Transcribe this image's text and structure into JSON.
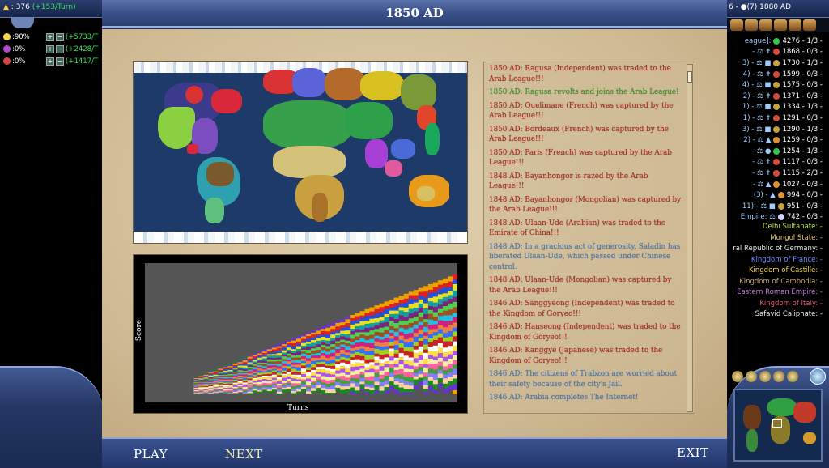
{
  "left_hud": {
    "gold": ": 376",
    "gold_rate": "(+153/Turn)",
    "rates": [
      {
        "label": ":90%",
        "gain": "(+5733/T",
        "color": "#f4d54a"
      },
      {
        "label": ":0%",
        "gain": "(+2428/T",
        "color": "#b24ad0"
      },
      {
        "label": ":0%",
        "gain": "(+1417/T",
        "color": "#d84444"
      }
    ]
  },
  "right_hud": {
    "top": "6 - ●(7) 1880 AD",
    "rows": [
      {
        "pre": "eague]:",
        "score": "4276 - 1/3 -",
        "color": "#2fc848"
      },
      {
        "pre": "- ⚖ ✝",
        "score": "1868 - 0/3 -",
        "color": "#d84b3b"
      },
      {
        "pre": "3) - ⚖ ■",
        "score": "1730 - 1/3 -",
        "color": "#c9a23a"
      },
      {
        "pre": "4) - ⚖ ✝",
        "score": "1599 - 0/3 -",
        "color": "#d84b3b"
      },
      {
        "pre": "4) - ⚖ ■",
        "score": "1575 - 0/3 -",
        "color": "#c9a23a"
      },
      {
        "pre": "2) - ⚖ ✝",
        "score": "1371 - 0/3 -",
        "color": "#d84b3b"
      },
      {
        "pre": "1) - ⚖ ■",
        "score": "1334 - 1/3 -",
        "color": "#c9a23a"
      },
      {
        "pre": "1) - ⚖ ✝",
        "score": "1291 - 0/3 -",
        "color": "#d84b3b"
      },
      {
        "pre": "3) - ⚖ ■",
        "score": "1290 - 1/3 -",
        "color": "#c9a23a"
      },
      {
        "pre": "2) - ⚖ ▲",
        "score": "1259 - 0/3 -",
        "color": "#e0902e"
      },
      {
        "pre": "- ⚖ ●",
        "score": "1254 - 1/3 -",
        "color": "#2fc848"
      },
      {
        "pre": "- ⚖ ✝",
        "score": "1117 - 0/3 -",
        "color": "#d84b3b"
      },
      {
        "pre": "- ⚖ ✝",
        "score": "1115 - 2/3 -",
        "color": "#d84b3b"
      },
      {
        "pre": "- ⚖ ▲",
        "score": "1027 - 0/3 -",
        "color": "#e0902e"
      },
      {
        "pre": "(3) - ▲",
        "score": "994 - 0/3 -",
        "color": "#e0902e"
      },
      {
        "pre": "11) - ⚖ ■",
        "score": "951 - 0/3 -",
        "color": "#c9a23a"
      },
      {
        "pre": "Empire: ⚖",
        "score": "742 - 0/3 -",
        "color": "#d8d8ff"
      }
    ],
    "civs": [
      {
        "name": "Delhi Sultanate:  -",
        "color": "#b9e04a"
      },
      {
        "name": "Mongol State:  -",
        "color": "#e0c46a"
      },
      {
        "name": "ral Republic of Germany:  -",
        "color": "#e8e8e8"
      },
      {
        "name": "Kingdom of France:  -",
        "color": "#6b8cff"
      },
      {
        "name": "Kingdom of Castille:  -",
        "color": "#f2d44a"
      },
      {
        "name": "Kingdom of Cambodia:  -",
        "color": "#c7a27a"
      },
      {
        "name": "Eastern Roman Empire:  -",
        "color": "#c27adf"
      },
      {
        "name": "Kingdom of Italy:  -",
        "color": "#e25a6a"
      },
      {
        "name": "Safavid Caliphate:  -",
        "color": "#e8e8e8"
      }
    ]
  },
  "dialog": {
    "title": "1850 AD",
    "graph_ylabel": "Score",
    "graph_xlabel": "Turns",
    "buttons": {
      "play": "PLAY",
      "next": "NEXT",
      "exit": "EXIT"
    }
  },
  "log": [
    {
      "text": "1850 AD: Ragusa (Independent) was traded to the Arab League!!!",
      "color": "#b5281f"
    },
    {
      "text": "1850 AD: Ragusa revolts and joins the Arab League!",
      "color": "#2f9a1f"
    },
    {
      "text": "1850 AD: Quelimane (French) was captured by the Arab League!!!",
      "color": "#b5281f"
    },
    {
      "text": "1850 AD: Bordeaux (French) was captured by the Arab League!!!",
      "color": "#b5281f"
    },
    {
      "text": "1850 AD: Paris (French) was captured by the Arab League!!!",
      "color": "#b5281f"
    },
    {
      "text": "1848 AD: Bayanhongor is razed by the Arab League!!!",
      "color": "#b5281f"
    },
    {
      "text": "1848 AD: Bayanhongor (Mongolian) was captured by the Arab League!!!",
      "color": "#b5281f"
    },
    {
      "text": "1848 AD: Ulaan-Ude (Arabian) was traded to the Emirate of China!!!",
      "color": "#b5281f"
    },
    {
      "text": "1848 AD: In a gracious act of generosity, Saladin has liberated Ulaan-Ude, which passed under Chinese control.",
      "color": "#4a7ab8"
    },
    {
      "text": "1848 AD: Ulaan-Ude (Mongolian) was captured by the Arab League!!!",
      "color": "#b5281f"
    },
    {
      "text": "1846 AD: Sanggyeong (Independent) was traded to the Kingdom of Goryeo!!!",
      "color": "#b5281f"
    },
    {
      "text": "1846 AD: Hanseong (Independent) was traded to the Kingdom of Goryeo!!!",
      "color": "#b5281f"
    },
    {
      "text": "1846 AD: Kanggye (Japanese) was traded to the Kingdom of Goryeo!!!",
      "color": "#b5281f"
    },
    {
      "text": "1846 AD: The citizens of Trabzon are worried about their safety because of the city's Jail.",
      "color": "#4a7ab8"
    },
    {
      "text": "1846 AD: Arabia completes The Internet!",
      "color": "#4a7ab8"
    }
  ],
  "chart_data": {
    "type": "area",
    "ylabel": "Score",
    "xlabel": "Turns",
    "stacked": true,
    "band_colors": [
      "#1a8a1a",
      "#6633cc",
      "#f0a000",
      "#e02020",
      "#2050e0",
      "#e8e020",
      "#10a0a0",
      "#802080",
      "#50d050",
      "#a05020",
      "#20c0e0",
      "#d02080",
      "#f08040",
      "#3070ff",
      "#a0d020",
      "#cc2222",
      "#ffffff",
      "#ffe040",
      "#b050f0",
      "#f0f0a0",
      "#ff60a0",
      "#40a040",
      "#8080ff",
      "#ffd0a0"
    ]
  }
}
